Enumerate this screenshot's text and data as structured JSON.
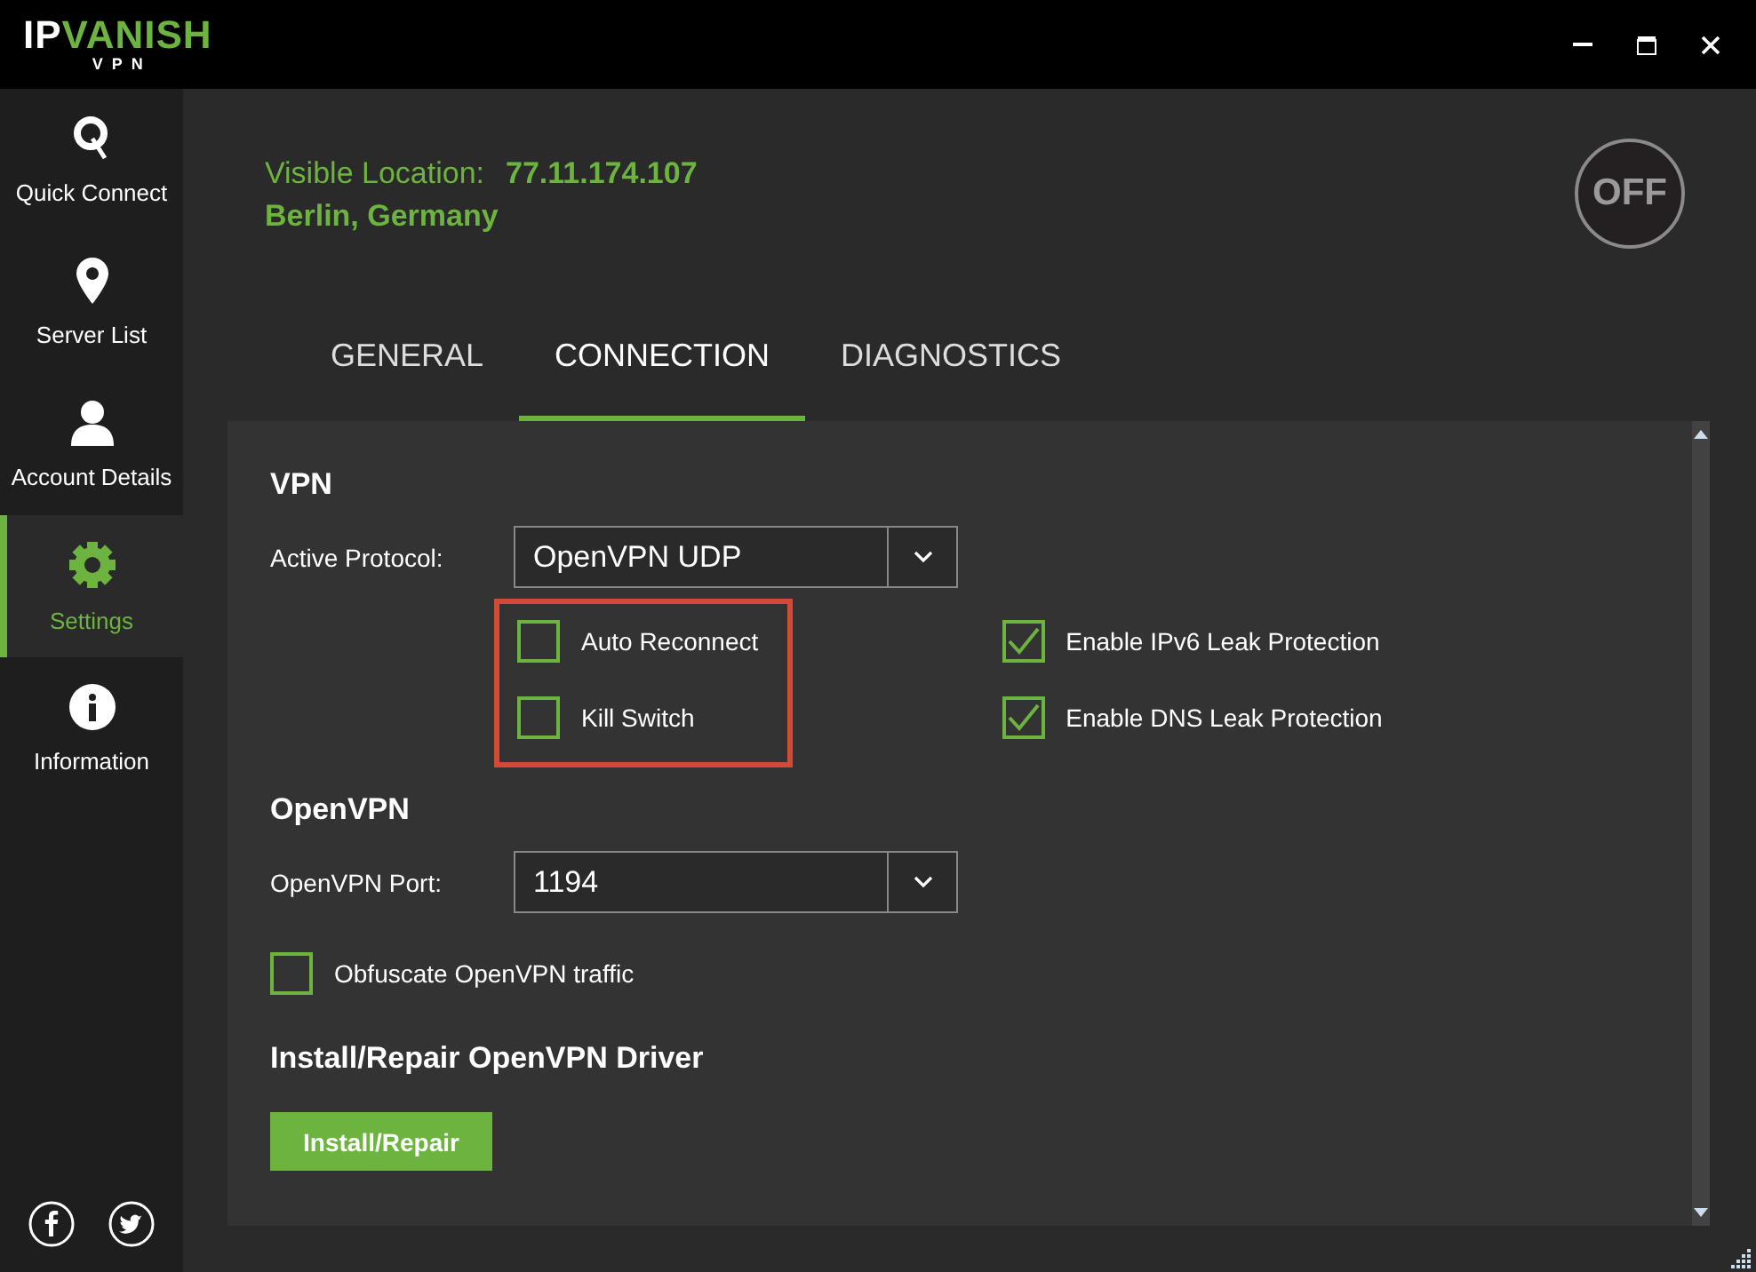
{
  "window": {
    "logo": {
      "part_1": "IP",
      "part_2": "VANISH",
      "subtitle": "VPN"
    }
  },
  "sidebar": {
    "items": [
      {
        "label": "Quick Connect",
        "kind": "connect",
        "selected": false
      },
      {
        "label": "Server List",
        "kind": "pin",
        "selected": false
      },
      {
        "label": "Account Details",
        "kind": "user",
        "selected": false
      },
      {
        "label": "Settings",
        "kind": "gear",
        "selected": true
      },
      {
        "label": "Information",
        "kind": "info",
        "selected": false
      }
    ],
    "social": [
      {
        "kind": "facebook"
      },
      {
        "kind": "twitter"
      }
    ]
  },
  "status": {
    "label": "Visible Location:",
    "ip": "77.11.174.107",
    "city": "Berlin, Germany",
    "power_button": "OFF"
  },
  "tabs": [
    {
      "label": "GENERAL",
      "selected": false
    },
    {
      "label": "CONNECTION",
      "selected": true
    },
    {
      "label": "DIAGNOSTICS",
      "selected": false
    }
  ],
  "vpn": {
    "heading": "VPN",
    "protocol": {
      "label": "Active Protocol:",
      "value": "OpenVPN UDP"
    },
    "option_groups": [
      {
        "highlighted": true,
        "options": [
          {
            "label": "Auto Reconnect",
            "checked": false
          },
          {
            "label": "Kill Switch",
            "checked": false
          }
        ]
      },
      {
        "highlighted": false,
        "options": [
          {
            "label": "Enable IPv6 Leak Protection",
            "checked": true
          },
          {
            "label": "Enable DNS Leak Protection",
            "checked": true
          }
        ]
      }
    ]
  },
  "openvpn": {
    "heading": "OpenVPN",
    "port": {
      "label": "OpenVPN Port:",
      "value": "1194"
    },
    "obfuscate": {
      "label": "Obfuscate OpenVPN traffic",
      "checked": false
    }
  },
  "driver": {
    "heading": "Install/Repair OpenVPN Driver",
    "button": "Install/Repair"
  }
}
